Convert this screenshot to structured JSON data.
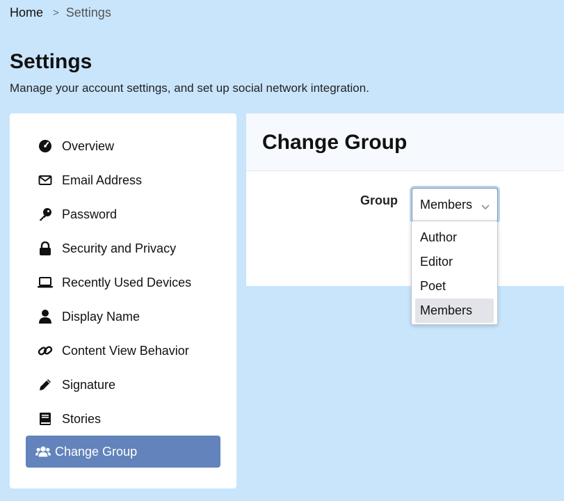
{
  "breadcrumb": {
    "home": "Home",
    "separator": ">",
    "current": "Settings"
  },
  "page": {
    "title": "Settings",
    "subtitle": "Manage your account settings, and set up social network integration."
  },
  "sidebar": {
    "items": [
      {
        "label": "Overview",
        "icon": "dashboard-gauge-icon"
      },
      {
        "label": "Email Address",
        "icon": "envelope-icon"
      },
      {
        "label": "Password",
        "icon": "key-icon"
      },
      {
        "label": "Security and Privacy",
        "icon": "lock-icon"
      },
      {
        "label": "Recently Used Devices",
        "icon": "laptop-icon"
      },
      {
        "label": "Display Name",
        "icon": "user-icon"
      },
      {
        "label": "Content View Behavior",
        "icon": "link-icon"
      },
      {
        "label": "Signature",
        "icon": "pencil-icon"
      },
      {
        "label": "Stories",
        "icon": "book-icon"
      },
      {
        "label": "Change Group",
        "icon": "users-icon",
        "active": true
      }
    ]
  },
  "panel": {
    "title": "Change Group",
    "group_label": "Group",
    "select_value": "Members",
    "options": [
      "Author",
      "Editor",
      "Poet",
      "Members"
    ],
    "selected_option": "Members"
  },
  "colors": {
    "background": "#c9e5fc",
    "active_item": "#6283bb",
    "selected_option": "#e3e4ea"
  }
}
